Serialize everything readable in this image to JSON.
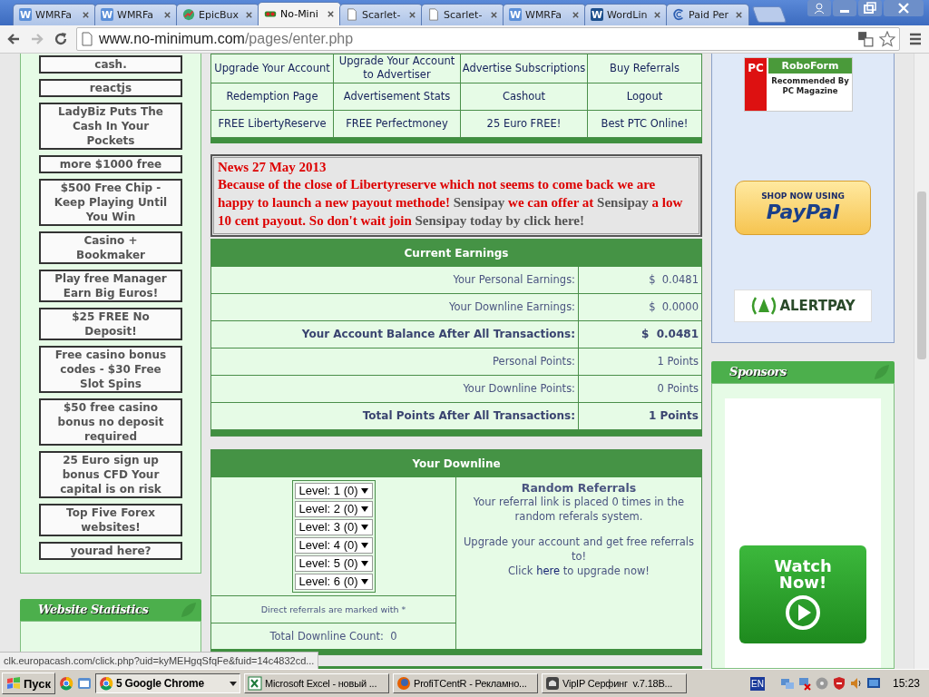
{
  "browser": {
    "tabs": [
      {
        "title": "WMRFa",
        "selected": false,
        "icon": {
          "kind": "letter",
          "glyph": "W",
          "color": "#5b8fd8"
        }
      },
      {
        "title": "WMRFa",
        "selected": false,
        "icon": {
          "kind": "letter",
          "glyph": "W",
          "color": "#5b8fd8"
        }
      },
      {
        "title": "EpicBux",
        "selected": false,
        "icon": {
          "kind": "chart"
        }
      },
      {
        "title": "No-Mini",
        "selected": true,
        "icon": {
          "kind": "cash"
        }
      },
      {
        "title": "Scarlet-",
        "selected": false,
        "icon": {
          "kind": "page"
        }
      },
      {
        "title": "Scarlet-",
        "selected": false,
        "icon": {
          "kind": "page"
        }
      },
      {
        "title": "WMRFa",
        "selected": false,
        "icon": {
          "kind": "letter",
          "glyph": "W",
          "color": "#5b8fd8"
        }
      },
      {
        "title": "WordLin",
        "selected": false,
        "icon": {
          "kind": "letter",
          "glyph": "W",
          "color": "#1d4f8c"
        }
      },
      {
        "title": "Paid Per",
        "selected": false,
        "icon": {
          "kind": "swirl"
        }
      }
    ],
    "address": {
      "host": "www.no-minimum.com",
      "path": "/pages/enter.php"
    }
  },
  "left_ads": [
    "cash.",
    "reactjs",
    "LadyBiz Puts The Cash In Your Pockets",
    "more $1000 free",
    "$500 Free Chip - Keep Playing Until You Win",
    "Casino + Bookmaker",
    "Play free Manager Earn Big Euros!",
    "$25 FREE No Deposit!",
    "Free casino bonus codes - $30 Free Slot Spins",
    "$50 free casino bonus no deposit required",
    "25 Euro sign up bonus CFD Your capital is on risk",
    "Top Five Forex websites!",
    "yourad here?"
  ],
  "stats_title": "Website Statistics",
  "nav_links": [
    [
      "Upgrade Your Account",
      "Upgrade Your Account to Advertiser",
      "Advertise Subscriptions",
      "Buy Referrals"
    ],
    [
      "Redemption Page",
      "Advertisement Stats",
      "Cashout",
      "Logout"
    ],
    [
      "FREE LibertyReserve",
      "FREE Perfectmoney",
      "25 Euro FREE!",
      "Best PTC Online!"
    ]
  ],
  "news": {
    "title": "News 27 May 2013",
    "segments": [
      {
        "text": "Because of the close of Libertyreserve which not seems to come back we are happy to launch a new payout methode! ",
        "highlight": true
      },
      {
        "text": "Sensipay ",
        "highlight": false
      },
      {
        "text": "we can offer at ",
        "highlight": true
      },
      {
        "text": "Sensipay ",
        "highlight": false
      },
      {
        "text": "a low 10 cent payout. So don't wait join ",
        "highlight": true
      },
      {
        "text": "Sensipay today by click here!",
        "highlight": false
      }
    ]
  },
  "earnings": {
    "title": "Current Earnings",
    "rows": [
      {
        "label": "Your Personal Earnings:",
        "value": "$  0.0481",
        "bold": false
      },
      {
        "label": "Your Downline Earnings:",
        "value": "$  0.0000",
        "bold": false
      },
      {
        "label": "Your Account Balance After All Transactions:",
        "value": "$  0.0481",
        "bold": true
      },
      {
        "label": "Personal Points:",
        "value": "1 Points",
        "bold": false
      },
      {
        "label": "Your Downline Points:",
        "value": "0 Points",
        "bold": false
      },
      {
        "label": "Total Points After All Transactions:",
        "value": "1 Points",
        "bold": true
      }
    ]
  },
  "downline": {
    "title": "Your Downline",
    "levels": [
      "Level: 1 (0)",
      "Level: 2 (0)",
      "Level: 3 (0)",
      "Level: 4 (0)",
      "Level: 5 (0)",
      "Level: 6 (0)"
    ],
    "note": "Direct referrals are marked with *",
    "total": "Total Downline Count:  0",
    "random": {
      "title": "Random Referrals",
      "text": "Your referral link is placed 0 times in the random referals system.",
      "upgrade": "Upgrade your account and get free referrals to!",
      "click_before": "Click",
      "click_link": "here",
      "click_after": "to upgrade now!"
    }
  },
  "right": {
    "roboform": {
      "badge": "PC",
      "name": "RoboForm",
      "tagline": "Recommended By PC Magazine"
    },
    "paypal": {
      "small": "SHOP NOW USING",
      "brand": "PayPal"
    },
    "alertpay": {
      "brand": "ALERTPAY"
    },
    "sponsors_title": "Sponsors",
    "watch_button": "Watch Now!"
  },
  "status_url": "clk.europacash.com/click.php?uid=kyMEHgqSfqFe&fuid=14c4832cd...",
  "taskbar": {
    "start": "Пуск",
    "tasks": [
      {
        "label": "5 Google Chrome",
        "selected": true,
        "kind": "chrome"
      },
      {
        "label": "Microsoft Excel - новый ...",
        "selected": false,
        "kind": "excel"
      },
      {
        "label": "ProfiTCentR - Рекламно...",
        "selected": false,
        "kind": "firefox"
      },
      {
        "label": "VipIP Серфинг  v.7.18B...",
        "selected": false,
        "kind": "vipip"
      }
    ],
    "lang": "EN",
    "time": "15:23"
  }
}
